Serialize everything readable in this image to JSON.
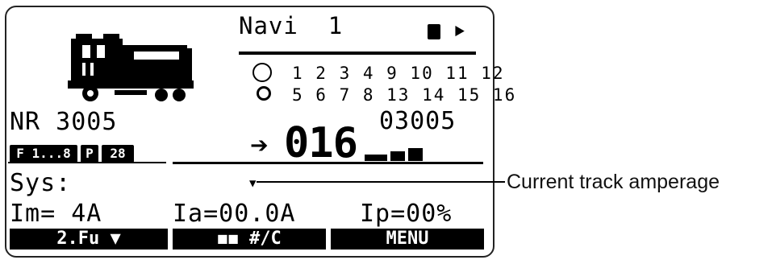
{
  "header": {
    "mode_title": "Navi",
    "slot_number": "1",
    "icons": [
      "battery-icon",
      "power-plug-icon"
    ]
  },
  "functions": {
    "row1": "1 2 3 4  9 10 11 12",
    "row2": "5 6 7 8  13 14 15 16",
    "indicator_icons": [
      "light-function-icon",
      "function-zero-icon"
    ]
  },
  "loco": {
    "name": "NR 3005",
    "image_icon": "locomotive-icon",
    "badges": [
      "F 1...8",
      "P",
      "28"
    ]
  },
  "drive": {
    "direction_icon": "forward-arrow-icon",
    "speed": "016",
    "address": "03005",
    "speed_bar_fraction": 0.3
  },
  "system": {
    "label": "Sys:",
    "im": "Im= 4A",
    "ia": "Ia=00.0A",
    "ip": "Ip=00%"
  },
  "softkeys": [
    "2.Fu ▼",
    "#/C",
    "MENU"
  ],
  "annotation": "Current track amperage",
  "colors": {
    "lcd_ink": "#000000",
    "lcd_bg": "#ffffff"
  }
}
